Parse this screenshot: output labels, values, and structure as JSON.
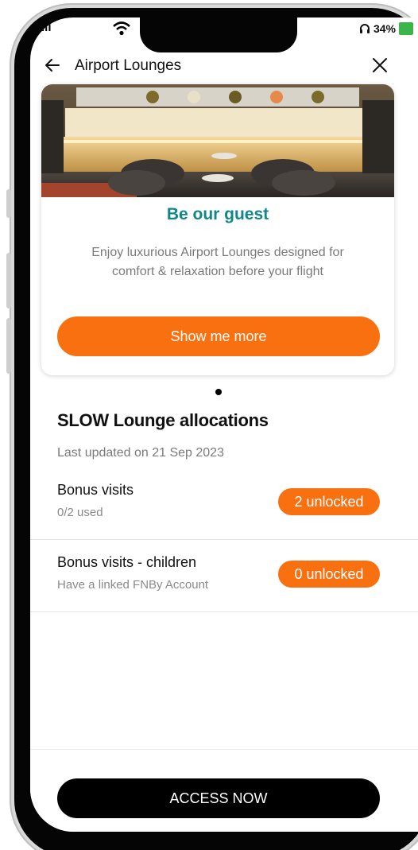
{
  "status_bar": {
    "signal": "ıll",
    "battery_percent": "34%",
    "battery_color": "#3bb54a"
  },
  "header": {
    "title": "Airport Lounges",
    "back_icon": "arrow-left-icon",
    "close_icon": "close-icon"
  },
  "promo_card": {
    "title": "Be our guest",
    "description": "Enjoy luxurious Airport Lounges designed for comfort & relaxation before your flight",
    "button_label": "Show me more"
  },
  "allocations": {
    "title": "SLOW Lounge allocations",
    "last_updated": "Last updated on 21 Sep 2023",
    "items": [
      {
        "title": "Bonus visits",
        "subtitle": "0/2 used",
        "badge": "2 unlocked"
      },
      {
        "title": "Bonus visits - children",
        "subtitle": "Have a linked FNBy Account",
        "badge": "0 unlocked"
      }
    ]
  },
  "footer": {
    "button_label": "ACCESS NOW"
  },
  "colors": {
    "accent": "#f97010",
    "title_teal": "#12878a"
  }
}
